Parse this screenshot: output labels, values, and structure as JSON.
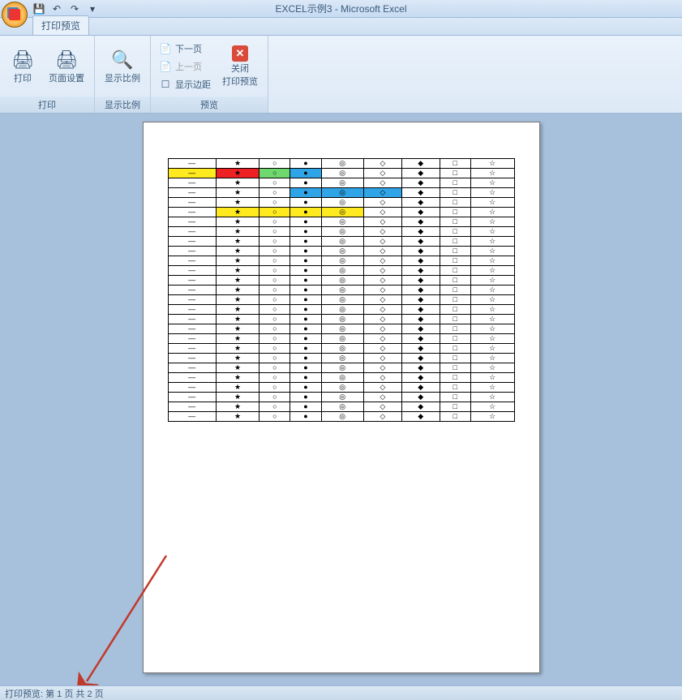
{
  "app_title": "EXCEL示例3 - Microsoft Excel",
  "tab_label": "打印预览",
  "ribbon": {
    "print": {
      "label": "打印",
      "print_btn": "打印",
      "page_setup": "页面设置"
    },
    "zoom": {
      "label": "显示比例",
      "zoom_btn": "显示比例"
    },
    "preview": {
      "label": "预览",
      "next": "下一页",
      "prev": "上一页",
      "margins": "显示边距",
      "close_line1": "关闭",
      "close_line2": "打印预览"
    }
  },
  "status_text": "打印预览: 第 1 页  共 2 页",
  "chart_data": {
    "type": "table",
    "columns": 9,
    "symbols": [
      "—",
      "★",
      "○",
      "●",
      "◎",
      "◇",
      "◆",
      "□",
      "☆"
    ],
    "rows": [
      {
        "cells": [
          "—",
          "★",
          "○",
          "●",
          "◎",
          "◇",
          "◆",
          "□",
          "☆"
        ],
        "bg": [
          "",
          "",
          "",
          "",
          "",
          "",
          "",
          "",
          ""
        ]
      },
      {
        "cells": [
          "—",
          "★",
          "○",
          "●",
          "◎",
          "◇",
          "◆",
          "□",
          "☆"
        ],
        "bg": [
          "yellow",
          "red",
          "green",
          "blue",
          "",
          "",
          "",
          "",
          ""
        ]
      },
      {
        "cells": [
          "—",
          "★",
          "○",
          "●",
          "◎",
          "◇",
          "◆",
          "□",
          "☆"
        ],
        "bg": [
          "",
          "",
          "",
          "",
          "",
          "",
          "",
          "",
          ""
        ]
      },
      {
        "cells": [
          "—",
          "★",
          "○",
          "●",
          "◎",
          "◇",
          "◆",
          "□",
          "☆"
        ],
        "bg": [
          "",
          "",
          "",
          "blue",
          "blue",
          "blue",
          "",
          "",
          ""
        ]
      },
      {
        "cells": [
          "—",
          "★",
          "○",
          "●",
          "◎",
          "◇",
          "◆",
          "□",
          "☆"
        ],
        "bg": [
          "",
          "",
          "",
          "",
          "",
          "",
          "",
          "",
          ""
        ]
      },
      {
        "cells": [
          "—",
          "★",
          "○",
          "●",
          "◎",
          "◇",
          "◆",
          "□",
          "☆"
        ],
        "bg": [
          "",
          "yellow",
          "yellow",
          "yellow",
          "yellow",
          "",
          "",
          "",
          ""
        ]
      },
      {
        "cells": [
          "—",
          "★",
          "○",
          "●",
          "◎",
          "◇",
          "◆",
          "□",
          "☆"
        ],
        "bg": [
          "",
          "",
          "",
          "",
          "",
          "",
          "",
          "",
          ""
        ]
      },
      {
        "cells": [
          "—",
          "★",
          "○",
          "●",
          "◎",
          "◇",
          "◆",
          "□",
          "☆"
        ],
        "bg": [
          "",
          "",
          "",
          "",
          "",
          "",
          "",
          "",
          ""
        ]
      },
      {
        "cells": [
          "—",
          "★",
          "○",
          "●",
          "◎",
          "◇",
          "◆",
          "□",
          "☆"
        ],
        "bg": [
          "",
          "",
          "",
          "",
          "",
          "",
          "",
          "",
          ""
        ]
      },
      {
        "cells": [
          "—",
          "★",
          "○",
          "●",
          "◎",
          "◇",
          "◆",
          "□",
          "☆"
        ],
        "bg": [
          "",
          "",
          "",
          "",
          "",
          "",
          "",
          "",
          ""
        ]
      },
      {
        "cells": [
          "—",
          "★",
          "○",
          "●",
          "◎",
          "◇",
          "◆",
          "□",
          "☆"
        ],
        "bg": [
          "",
          "",
          "",
          "",
          "",
          "",
          "",
          "",
          ""
        ]
      },
      {
        "cells": [
          "—",
          "★",
          "○",
          "●",
          "◎",
          "◇",
          "◆",
          "□",
          "☆"
        ],
        "bg": [
          "",
          "",
          "",
          "",
          "",
          "",
          "",
          "",
          ""
        ]
      },
      {
        "cells": [
          "—",
          "★",
          "○",
          "●",
          "◎",
          "◇",
          "◆",
          "□",
          "☆"
        ],
        "bg": [
          "",
          "",
          "",
          "",
          "",
          "",
          "",
          "",
          ""
        ]
      },
      {
        "cells": [
          "—",
          "★",
          "○",
          "●",
          "◎",
          "◇",
          "◆",
          "□",
          "☆"
        ],
        "bg": [
          "",
          "",
          "",
          "",
          "",
          "",
          "",
          "",
          ""
        ]
      },
      {
        "cells": [
          "—",
          "★",
          "○",
          "●",
          "◎",
          "◇",
          "◆",
          "□",
          "☆"
        ],
        "bg": [
          "",
          "",
          "",
          "",
          "",
          "",
          "",
          "",
          ""
        ]
      },
      {
        "cells": [
          "—",
          "★",
          "○",
          "●",
          "◎",
          "◇",
          "◆",
          "□",
          "☆"
        ],
        "bg": [
          "",
          "",
          "",
          "",
          "",
          "",
          "",
          "",
          ""
        ]
      },
      {
        "cells": [
          "—",
          "★",
          "○",
          "●",
          "◎",
          "◇",
          "◆",
          "□",
          "☆"
        ],
        "bg": [
          "",
          "",
          "",
          "",
          "",
          "",
          "",
          "",
          ""
        ]
      },
      {
        "cells": [
          "—",
          "★",
          "○",
          "●",
          "◎",
          "◇",
          "◆",
          "□",
          "☆"
        ],
        "bg": [
          "",
          "",
          "",
          "",
          "",
          "",
          "",
          "",
          ""
        ]
      },
      {
        "cells": [
          "—",
          "★",
          "○",
          "●",
          "◎",
          "◇",
          "◆",
          "□",
          "☆"
        ],
        "bg": [
          "",
          "",
          "",
          "",
          "",
          "",
          "",
          "",
          ""
        ]
      },
      {
        "cells": [
          "—",
          "★",
          "○",
          "●",
          "◎",
          "◇",
          "◆",
          "□",
          "☆"
        ],
        "bg": [
          "",
          "",
          "",
          "",
          "",
          "",
          "",
          "",
          ""
        ]
      },
      {
        "cells": [
          "—",
          "★",
          "○",
          "●",
          "◎",
          "◇",
          "◆",
          "□",
          "☆"
        ],
        "bg": [
          "",
          "",
          "",
          "",
          "",
          "",
          "",
          "",
          ""
        ]
      },
      {
        "cells": [
          "—",
          "★",
          "○",
          "●",
          "◎",
          "◇",
          "◆",
          "□",
          "☆"
        ],
        "bg": [
          "",
          "",
          "",
          "",
          "",
          "",
          "",
          "",
          ""
        ]
      },
      {
        "cells": [
          "—",
          "★",
          "○",
          "●",
          "◎",
          "◇",
          "◆",
          "□",
          "☆"
        ],
        "bg": [
          "",
          "",
          "",
          "",
          "",
          "",
          "",
          "",
          ""
        ]
      },
      {
        "cells": [
          "—",
          "★",
          "○",
          "●",
          "◎",
          "◇",
          "◆",
          "□",
          "☆"
        ],
        "bg": [
          "",
          "",
          "",
          "",
          "",
          "",
          "",
          "",
          ""
        ]
      },
      {
        "cells": [
          "—",
          "★",
          "○",
          "●",
          "◎",
          "◇",
          "◆",
          "□",
          "☆"
        ],
        "bg": [
          "",
          "",
          "",
          "",
          "",
          "",
          "",
          "",
          ""
        ]
      },
      {
        "cells": [
          "—",
          "★",
          "○",
          "●",
          "◎",
          "◇",
          "◆",
          "□",
          "☆"
        ],
        "bg": [
          "",
          "",
          "",
          "",
          "",
          "",
          "",
          "",
          ""
        ]
      },
      {
        "cells": [
          "—",
          "★",
          "○",
          "●",
          "◎",
          "◇",
          "◆",
          "□",
          "☆"
        ],
        "bg": [
          "",
          "",
          "",
          "",
          "",
          "",
          "",
          "",
          ""
        ]
      }
    ]
  }
}
